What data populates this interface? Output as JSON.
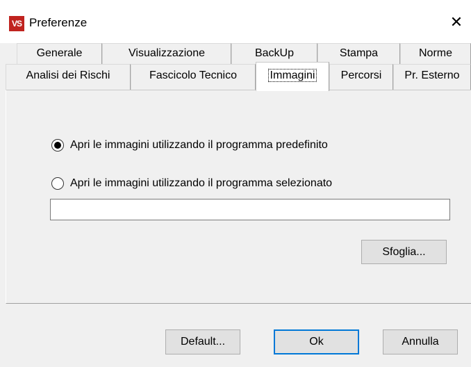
{
  "window": {
    "title": "Preferenze",
    "logo_text": "VS",
    "close_glyph": "✕"
  },
  "tabs": {
    "row1": [
      "Generale",
      "Visualizzazione",
      "BackUp",
      "Stampa",
      "Norme"
    ],
    "row2": [
      "Analisi dei Rischi",
      "Fascicolo Tecnico",
      "Immagini",
      "Percorsi",
      "Pr. Esterno"
    ],
    "active": "Immagini"
  },
  "images_tab": {
    "radio_default_label": "Apri le immagini utilizzando il programma predefinito",
    "radio_selected_label": "Apri le immagini utilizzando il programma selezionato",
    "selected_option": "predefinito",
    "path_value": "",
    "browse_label": "Sfoglia..."
  },
  "footer": {
    "default_label": "Default...",
    "ok_label": "Ok",
    "cancel_label": "Annulla"
  },
  "colors": {
    "logo_red": "#c0231f",
    "focus_blue": "#0078d7",
    "dialog_gray": "#f0f0f0"
  }
}
